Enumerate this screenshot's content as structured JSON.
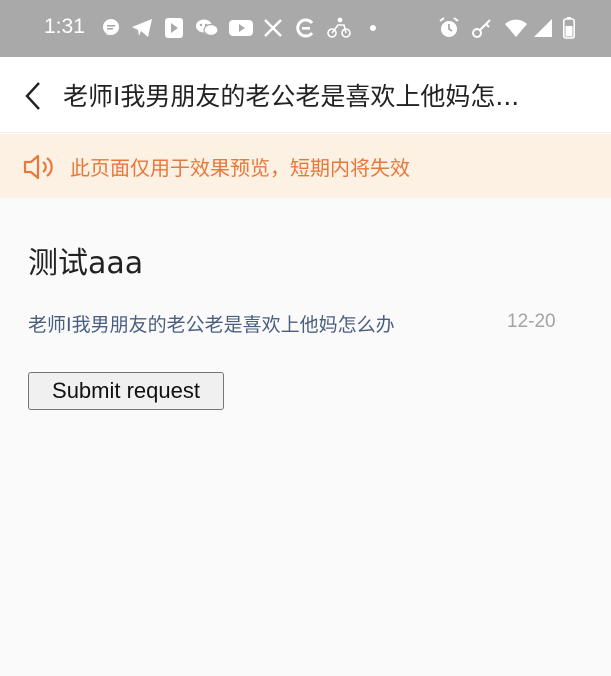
{
  "status_bar": {
    "time": "1:31",
    "left_icons": [
      "message-bubble-icon",
      "telegram-icon",
      "flag-icon",
      "wechat-icon",
      "youtube-icon",
      "x-icon",
      "refresh-e-icon",
      "motorbike-icon",
      "dot-icon"
    ],
    "right_icons": [
      "alarm-icon",
      "key-icon",
      "wifi-icon",
      "signal-icon",
      "battery-icon"
    ]
  },
  "nav": {
    "back_icon": "chevron-left-icon",
    "title": "老师I我男朋友的老公老是喜欢上他妈怎..."
  },
  "notice": {
    "icon": "speaker-icon",
    "text": "此页面仅用于效果预览，短期内将失效",
    "color": "#e8773a",
    "background": "#fdf1e4"
  },
  "post": {
    "title": "测试aaa",
    "link_text": "老师I我男朋友的老公老是喜欢上他妈怎么办",
    "date": "12-20",
    "submit_label": "Submit request"
  }
}
